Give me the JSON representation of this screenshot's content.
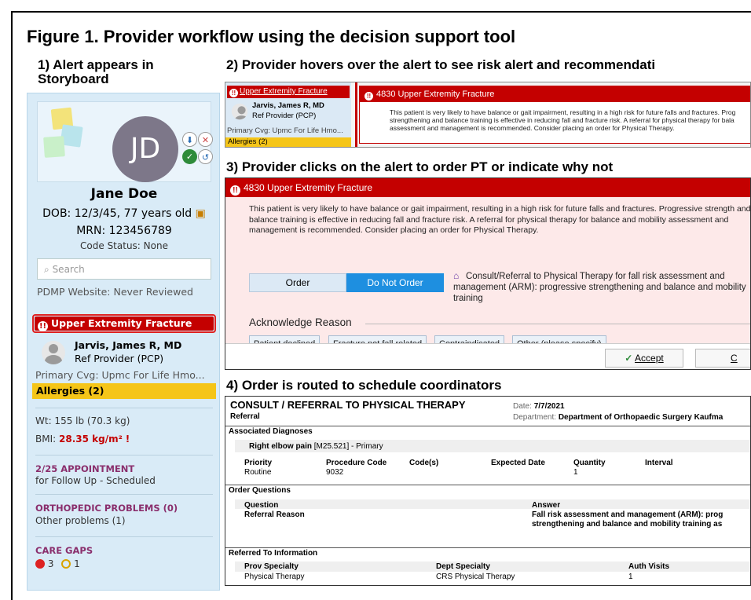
{
  "figure_title": "Figure 1. Provider workflow using the decision support tool",
  "steps": {
    "s1_line1": "1) Alert appears in",
    "s1_line2": "Storyboard",
    "s2": "2) Provider hovers over the alert to see risk alert and recommendati",
    "s3": "3) Provider clicks on the alert to order PT or indicate why not",
    "s4": "4) Order is routed to schedule coordinators"
  },
  "storyboard": {
    "initials": "JD",
    "patient_name": "Jane Doe",
    "dob": "DOB: 12/3/45, 77 years old",
    "mrn": "MRN: 123456789",
    "code_status": "Code Status: None",
    "search_placeholder": "Search",
    "pdmp": "PDMP Website: Never Reviewed",
    "alert_label": "Upper Extremity Fracture",
    "provider_name": "Jarvis, James R, MD",
    "provider_role": "Ref Provider (PCP)",
    "coverage": "Primary Cvg: Upmc For Life Hmo...",
    "allergies": "Allergies (2)",
    "weight": "Wt:  155 lb (70.3 kg)",
    "bmi_label": "BMI:",
    "bmi_value": "28.35 kg/m²",
    "bmi_flag": "!",
    "appt_head": "2/25 APPOINTMENT",
    "appt_sub": "for Follow Up - Scheduled",
    "ortho_head": "ORTHOPEDIC PROBLEMS (0)",
    "ortho_sub": "Other problems (1)",
    "care_gaps_head": "CARE GAPS",
    "care_gaps_red": "3",
    "care_gaps_yellow": "1",
    "colors": {
      "alert_red": "#c40000",
      "allergy_yellow": "#f5c518",
      "panel_blue": "#d9ebf7",
      "bmi_red": "#c40000",
      "section_purple": "#8a2f6d"
    }
  },
  "panel2": {
    "alert_link": "Upper Extremity Fracture",
    "provider_name": "Jarvis, James R, MD",
    "provider_role": "Ref Provider (PCP)",
    "coverage": "Primary Cvg: Upmc For Life Hmo...",
    "allergies": "Allergies (2)",
    "popup_title": "4830 Upper Extremity Fracture",
    "popup_line1": "This patient is very likely to have balance or gait impairment, resulting in a high risk for future falls and fractures. Prog",
    "popup_line2": "strengthening and balance training is effective in reducing fall and fracture risk. A referral for physical therapy for bala",
    "popup_line3": "assessment and management is recommended.  Consider placing an order for Physical Therapy."
  },
  "panel3": {
    "title": "4830 Upper Extremity Fracture",
    "body": "This patient is very likely to have balance or gait impairment, resulting in a high risk for future falls and fractures. Progressive strength and balance training is effective in reducing fall and fracture risk. A referral for physical therapy for balance and mobility assessment and management is recommended.  Consider placing an order for Physical Therapy.",
    "order_btn": "Order",
    "do_not_order_btn": "Do Not Order",
    "consult_text": "Consult/Referral to Physical Therapy for fall risk assessment and management (ARM): progressive strengthening and balance and mobility training",
    "ack_label": "Acknowledge Reason",
    "reasons": [
      "Patient declined",
      "Fracture not fall related",
      "Contraindicated",
      "Other (please specify)"
    ],
    "accept_btn": "Accept",
    "cancel_btn": "C"
  },
  "panel4": {
    "title": "CONSULT / REFERRAL TO PHYSICAL THERAPY",
    "subtitle": "Referral",
    "date_label": "Date:",
    "date_value": "7/7/2021",
    "dept_label": "Department:",
    "dept_value": "Department of Orthopaedic Surgery Kaufma",
    "assoc_dx_head": "Associated Diagnoses",
    "dx_name": "Right elbow pain",
    "dx_code": "[M25.521]  - Primary",
    "order_cols": [
      "Priority",
      "Procedure Code",
      "Code(s)",
      "Expected Date",
      "Quantity",
      "Interval"
    ],
    "order_vals": [
      "Routine",
      "9032",
      "",
      "",
      "1",
      ""
    ],
    "oq_head": "Order Questions",
    "q_col": "Question",
    "a_col": "Answer",
    "question": "Referral Reason",
    "answer_line1": "Fall risk assessment and management (ARM): prog",
    "answer_line2": "strengthening and balance and mobility training as",
    "ref_head": "Referred To Information",
    "ref_cols": [
      "Prov Specialty",
      "Dept Specialty",
      "Auth Visits"
    ],
    "ref_vals": [
      "Physical Therapy",
      "CRS Physical Therapy",
      "1"
    ]
  }
}
